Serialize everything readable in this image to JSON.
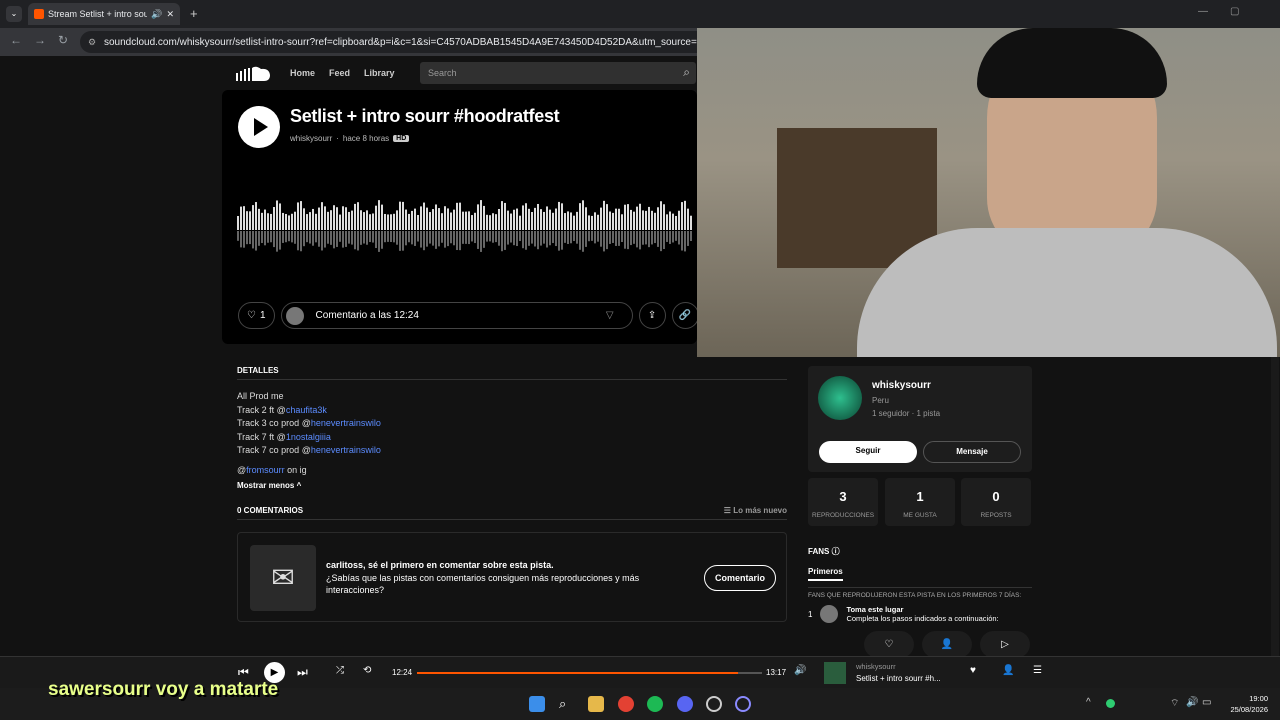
{
  "browser": {
    "tab_title": "Stream Setlist + intro sourr",
    "url": "soundcloud.com/whiskysourr/setlist-intro-sourr?ref=clipboard&p=i&c=1&si=C4570ADBAB1545D4A9E743450D4D52DA&utm_source=clipboard"
  },
  "nav": {
    "home": "Home",
    "feed": "Feed",
    "library": "Library",
    "search_placeholder": "Search"
  },
  "track": {
    "title": "Setlist + intro sourr #hoodratfest",
    "artist": "whiskysourr",
    "time": "hace 8 horas",
    "quality": "HD",
    "likes": "1",
    "comment_placeholder": "Comentario a las 12:24"
  },
  "details": {
    "header": "DETALLES",
    "lines": [
      {
        "pre": "All Prod me",
        "link": "",
        "post": ""
      },
      {
        "pre": "Track 2 ft @",
        "link": "chaufita3k",
        "post": ""
      },
      {
        "pre": "Track 3 co prod @",
        "link": "henevertrainswilo",
        "post": ""
      },
      {
        "pre": "Track 7 ft @",
        "link": "1nostalgiiia",
        "post": ""
      },
      {
        "pre": "Track 7 co prod @",
        "link": "henevertrainswilo",
        "post": ""
      }
    ],
    "ig_pre": "@",
    "ig_link": "fromsourr",
    "ig_post": " on ig",
    "show_less": "Mostrar menos"
  },
  "comments": {
    "header": "0 COMENTARIOS",
    "sort": "Lo más nuevo",
    "prompt_title": "carlitoss, sé el primero en comentar sobre esta pista.",
    "prompt_body": "¿Sabías que las pistas con comentarios consiguen más reproducciones y más interacciones?",
    "button": "Comentario"
  },
  "user": {
    "name": "whiskysourr",
    "country": "Peru",
    "followers": "1 seguidor · 1 pista",
    "follow": "Seguir",
    "message": "Mensaje"
  },
  "stats": [
    {
      "value": "3",
      "label": "REPRODUCCIONES"
    },
    {
      "value": "1",
      "label": "ME GUSTA"
    },
    {
      "value": "0",
      "label": "REPOSTS"
    }
  ],
  "fans": {
    "header": "FANS",
    "tab": "Primeros",
    "desc": "FANS QUE REPRODUJERON ESTA PISTA EN LOS PRIMEROS 7 DÍAS:",
    "rank": "1",
    "item_title": "Toma este lugar",
    "item_sub": "Completa los pasos indicados a continuación:"
  },
  "player": {
    "elapsed": "12:24",
    "duration": "13:17",
    "progress": 0.93,
    "artist": "whiskysourr",
    "title": "Setlist + intro sourr #h..."
  },
  "overlay_text": "sawersourr  voy a matarte",
  "taskbar": {
    "time": "19:00",
    "date": "25/08/2026"
  }
}
